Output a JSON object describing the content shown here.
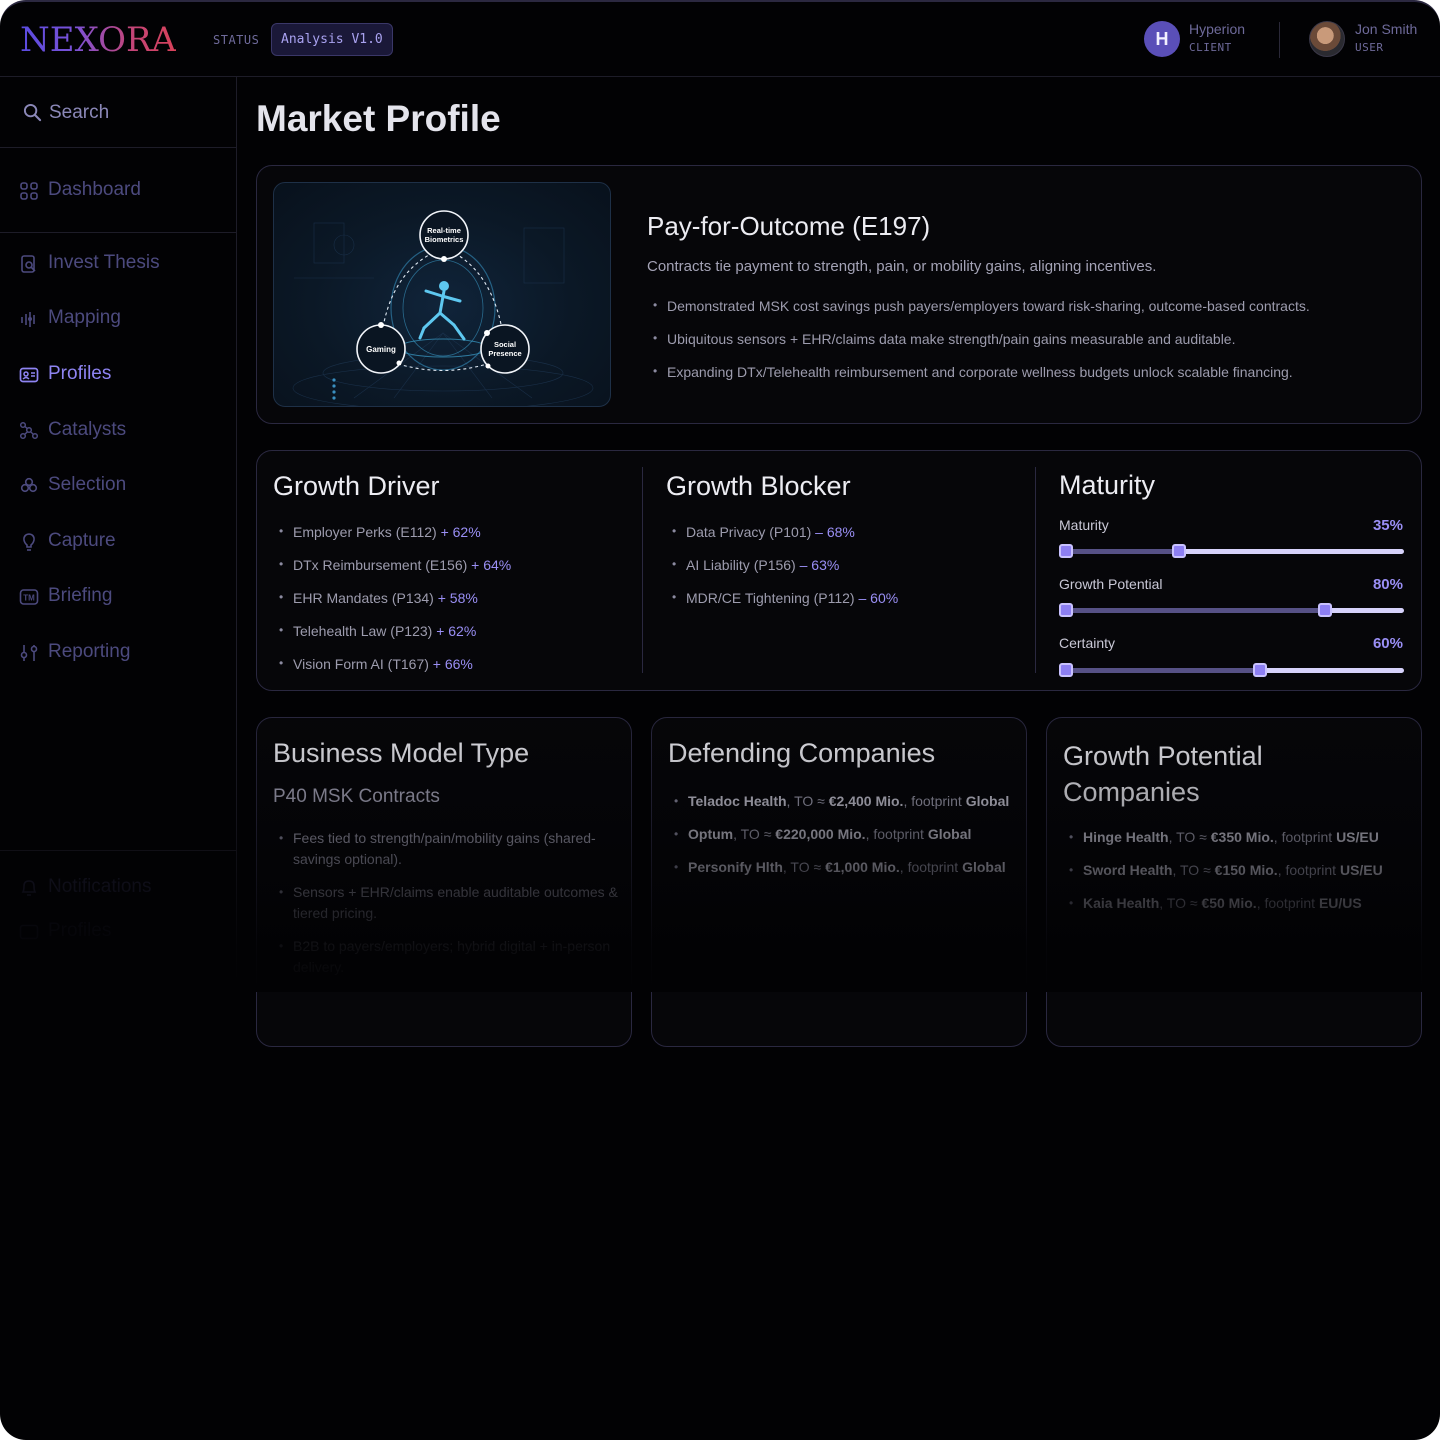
{
  "header": {
    "logo": "NEXORA",
    "status_label": "STATUS",
    "status_value": "Analysis V1.0",
    "client": {
      "initial": "H",
      "name": "Hyperion",
      "role": "CLIENT"
    },
    "user": {
      "name": "Jon Smith",
      "role": "USER"
    }
  },
  "sidebar": {
    "search_label": "Search",
    "items": [
      {
        "label": "Dashboard",
        "icon": "grid-icon"
      },
      {
        "label": "Invest Thesis",
        "icon": "document-search-icon"
      },
      {
        "label": "Mapping",
        "icon": "equalizer-icon"
      },
      {
        "label": "Profiles",
        "icon": "id-card-icon",
        "active": true
      },
      {
        "label": "Catalysts",
        "icon": "molecule-icon"
      },
      {
        "label": "Selection",
        "icon": "stack-icon"
      },
      {
        "label": "Capture",
        "icon": "lightbulb-icon"
      },
      {
        "label": "Briefing",
        "icon": "trademark-icon"
      },
      {
        "label": "Reporting",
        "icon": "sliders-icon"
      }
    ],
    "bottom_items": [
      {
        "label": "Notifications",
        "icon": "bell-icon"
      },
      {
        "label": "Profiles",
        "icon": "id-card-icon"
      }
    ]
  },
  "page": {
    "title": "Market Profile"
  },
  "hero": {
    "image_labels": {
      "top": "Real-time Biometrics",
      "left": "Gaming",
      "right": "Social Presence"
    },
    "title": "Pay-for-Outcome (E197)",
    "subtitle": "Contracts tie payment to strength, pain, or mobility gains, aligning incentives.",
    "bullets": [
      "Demonstrated MSK cost savings push payers/employers toward risk-sharing, outcome-based contracts.",
      "Ubiquitous sensors + EHR/claims data make strength/pain gains measurable and auditable.",
      "Expanding DTx/Telehealth reimbursement and corporate wellness budgets unlock scalable financing."
    ]
  },
  "growth_driver": {
    "title": "Growth Driver",
    "items": [
      {
        "label": "Employer Perks (E112)",
        "value": "+ 62%"
      },
      {
        "label": "DTx Reimbursement (E156)",
        "value": "+ 64%"
      },
      {
        "label": "EHR Mandates (P134)",
        "value": "+ 58%"
      },
      {
        "label": "Telehealth Law (P123)",
        "value": "+ 62%"
      },
      {
        "label": "Vision Form AI (T167)",
        "value": "+ 66%"
      }
    ]
  },
  "growth_blocker": {
    "title": "Growth Blocker",
    "items": [
      {
        "label": "Data Privacy (P101)",
        "value": "– 68%"
      },
      {
        "label": "AI Liability (P156)",
        "value": "– 63%"
      },
      {
        "label": "MDR/CE Tightening (P112)",
        "value": "– 60%"
      }
    ]
  },
  "maturity": {
    "title": "Maturity",
    "sliders": [
      {
        "label": "Maturity",
        "value_text": "35%",
        "value": 0.35
      },
      {
        "label": "Growth Potential",
        "value_text": "80%",
        "value": 0.8
      },
      {
        "label": "Certainty",
        "value_text": "60%",
        "value": 0.6
      }
    ]
  },
  "business_model": {
    "title": "Business Model Type",
    "subtitle": "P40 MSK Contracts",
    "bullets": [
      "Fees tied to strength/pain/mobility gains (shared-savings optional).",
      "Sensors + EHR/claims enable auditable outcomes & tiered pricing.",
      "B2B to payers/employers; hybrid digital + in-person delivery."
    ]
  },
  "defending": {
    "title": "Defending Companies",
    "items": [
      {
        "name": "Teladoc Health",
        "to_label": ", TO ≈ ",
        "to": "€2,400 Mio.",
        "fp_label": ", footprint ",
        "footprint": "Global"
      },
      {
        "name": "Optum",
        "to_label": ", TO ≈ ",
        "to": "€220,000 Mio.",
        "fp_label": ", footprint ",
        "footprint": "Global"
      },
      {
        "name": "Personify Hlth",
        "to_label": ", TO ≈ ",
        "to": "€1,000 Mio.",
        "fp_label": ", footprint ",
        "footprint": "Global"
      }
    ]
  },
  "growth_companies": {
    "title": "Growth Potential Companies",
    "items": [
      {
        "name": "Hinge Health",
        "to_label": ", TO ≈ ",
        "to": "€350 Mio.",
        "fp_label": ", footprint ",
        "footprint": "US/EU"
      },
      {
        "name": "Sword Health",
        "to_label": ", TO ≈ ",
        "to": "€150 Mio.",
        "fp_label": ", footprint ",
        "footprint": "US/EU"
      },
      {
        "name": "Kaia Health",
        "to_label": ", TO ≈ ",
        "to": "€50 Mio.",
        "fp_label": ", footprint ",
        "footprint": "EU/US"
      }
    ]
  },
  "colors": {
    "accent": "#8e84f2",
    "background": "#020204",
    "card_border": "#2a2840"
  }
}
